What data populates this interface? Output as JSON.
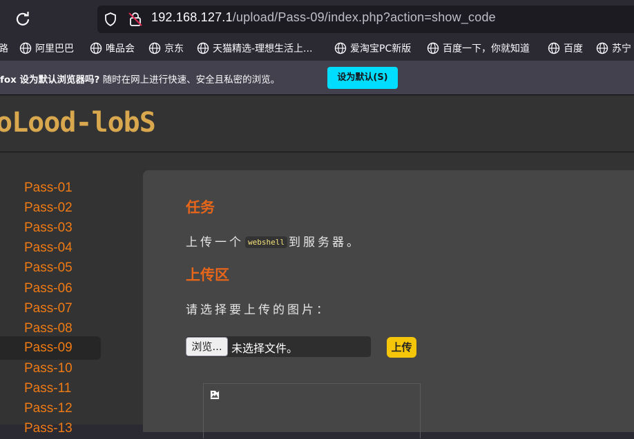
{
  "browser": {
    "url_host": "192.168.127.1",
    "url_path": "/upload/Pass-09/index.php?action=show_code",
    "bookmarks": [
      "路",
      "阿里巴巴",
      "唯品会",
      "京东",
      "天猫精选-理想生活上...",
      "爱淘宝PC新版",
      "百度一下，你就知道",
      "百度",
      "苏宁"
    ],
    "notice_bold": "fox 设为默认浏览器吗?",
    "notice_text": "随时在网上进行快速、安全且私密的浏览。",
    "notice_button": "设为默认(S)"
  },
  "site": {
    "logo_text": "oLood-lobS"
  },
  "sidebar": {
    "items": [
      "Pass-01",
      "Pass-02",
      "Pass-03",
      "Pass-04",
      "Pass-05",
      "Pass-06",
      "Pass-07",
      "Pass-08",
      "Pass-09",
      "Pass-10",
      "Pass-11",
      "Pass-12",
      "Pass-13"
    ],
    "active": "Pass-09"
  },
  "main": {
    "task_heading": "任务",
    "task_text_before": "上传一个",
    "task_code": "webshell",
    "task_text_after": "到服务器。",
    "upload_heading": "上传区",
    "choose_label": "请选择要上传的图片：",
    "browse_button": "浏览...",
    "file_status": "未选择文件。",
    "upload_button": "上传"
  },
  "colors": {
    "accent_orange": "#f07b14",
    "logo_gold": "#d9a84e",
    "button_yellow": "#f5c50a",
    "firefox_cyan": "#00ddff"
  }
}
